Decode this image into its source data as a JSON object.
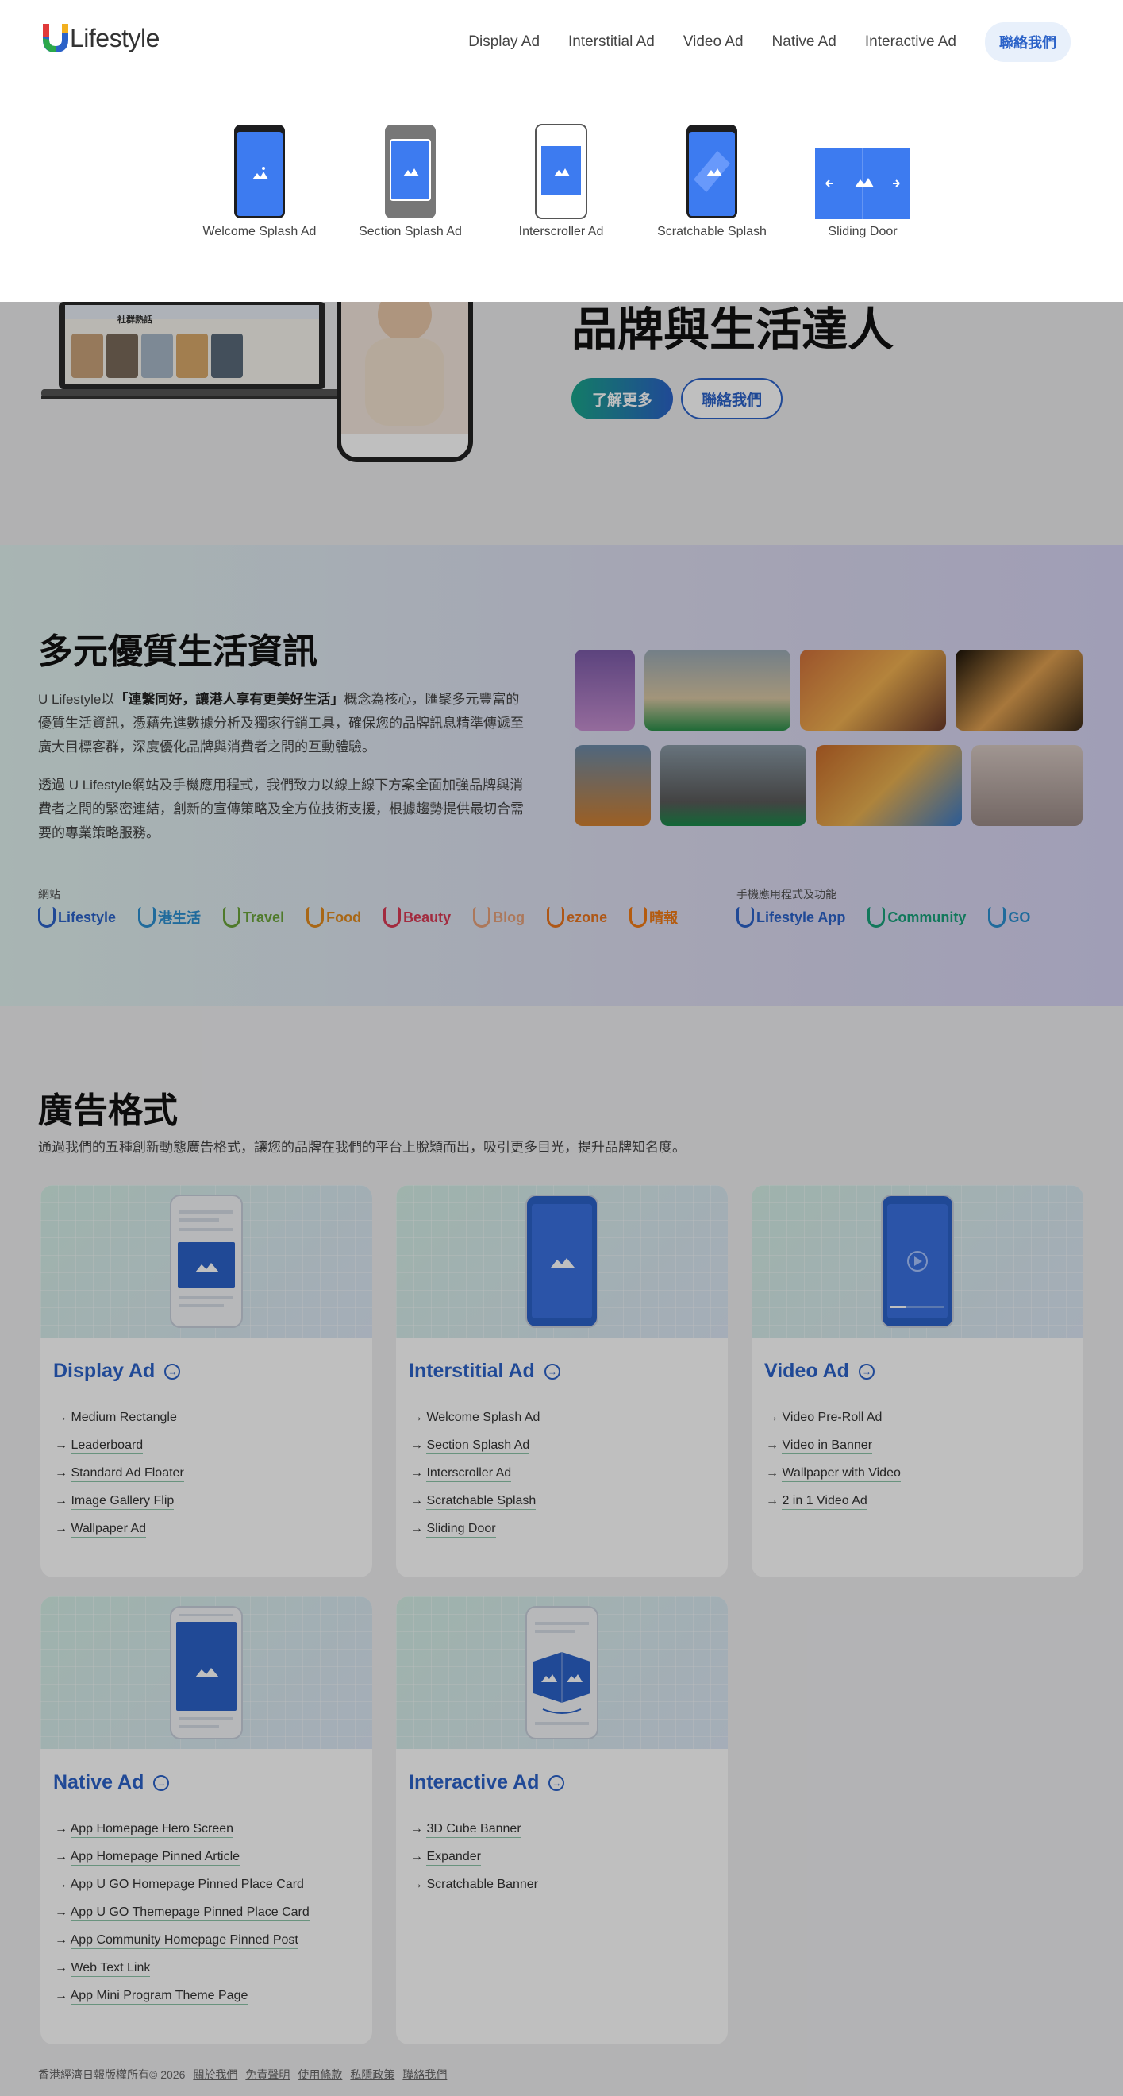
{
  "header": {
    "logo_text": "Lifestyle",
    "nav": [
      "Display Ad",
      "Interstitial Ad",
      "Video Ad",
      "Native Ad",
      "Interactive Ad"
    ],
    "contact_label": "聯絡我們"
  },
  "dropdown": {
    "items": [
      {
        "label": "Welcome Splash Ad"
      },
      {
        "label": "Section Splash Ad"
      },
      {
        "label": "Interscroller Ad"
      },
      {
        "label": "Scratchable Splash"
      },
      {
        "label": "Sliding Door"
      }
    ]
  },
  "hero": {
    "title": "品牌與生活達人",
    "learn_more": "了解更多",
    "contact": "聯絡我們",
    "laptop_heading": "社群熱話"
  },
  "info": {
    "title": "多元優質生活資訊",
    "para1_prefix": "U Lifestyle以",
    "para1_bold": "「連繫同好，讓港人享有更美好生活」",
    "para1_suffix": "概念為核心，匯聚多元豐富的優質生活資訊，憑藉先進數據分析及獨家行銷工具，確保您的品牌訊息精準傳遞至廣大目標客群，深度優化品牌與消費者之間的互動體驗。",
    "para2": "透過 U Lifestyle網站及手機應用程式，我們致力以線上線下方案全面加強品牌與消費者之間的緊密連結，創新的宣傳策略及全方位技術支援，根據趨勢提供最切合需要的專業策略服務。",
    "websites_label": "網站",
    "apps_label": "手機應用程式及功能",
    "websites": [
      {
        "name": "Lifestyle",
        "color": "#2b62c8"
      },
      {
        "name": "港生活",
        "color": "#2b8fd0"
      },
      {
        "name": "Travel",
        "color": "#6aa33a"
      },
      {
        "name": "Food",
        "color": "#e08a1e"
      },
      {
        "name": "Beauty",
        "color": "#d83a55"
      },
      {
        "name": "Blog",
        "color": "#e6a07a"
      },
      {
        "name": "ezone",
        "color": "#e8741e"
      },
      {
        "name": "晴報",
        "color": "#f07a14"
      }
    ],
    "apps": [
      {
        "name": "Lifestyle App",
        "color": "#2b62c8"
      },
      {
        "name": "Community",
        "color": "#18a07a"
      },
      {
        "name": "GO",
        "color": "#2b8fd0"
      }
    ]
  },
  "formats": {
    "title": "廣告格式",
    "subtitle": "通過我們的五種創新動態廣告格式，讓您的品牌在我們的平台上脫穎而出，吸引更多目光，提升品牌知名度。",
    "cards": [
      {
        "title": "Display Ad",
        "items": [
          "Medium Rectangle",
          "Leaderboard",
          "Standard Ad Floater",
          "Image Gallery Flip",
          "Wallpaper Ad"
        ]
      },
      {
        "title": "Interstitial Ad",
        "items": [
          "Welcome Splash Ad",
          "Section Splash Ad",
          "Interscroller Ad",
          "Scratchable Splash",
          "Sliding Door"
        ]
      },
      {
        "title": "Video Ad",
        "items": [
          "Video Pre-Roll Ad",
          "Video in Banner",
          "Wallpaper with Video",
          "2 in 1 Video Ad"
        ]
      },
      {
        "title": "Native Ad",
        "items": [
          "App Homepage Hero Screen",
          "App Homepage Pinned Article",
          "App U GO Homepage Pinned Place Card",
          "App U GO Themepage Pinned Place Card",
          "App Community Homepage Pinned Post",
          "Web Text Link",
          "App Mini Program Theme Page"
        ]
      },
      {
        "title": "Interactive Ad",
        "items": [
          "3D Cube Banner",
          "Expander",
          "Scratchable Banner"
        ]
      }
    ]
  },
  "footer": {
    "copyright": "香港經濟日報版權所有© 2026",
    "links": [
      "關於我們",
      "免責聲明",
      "使用條款",
      "私隱政策",
      "聯絡我們"
    ]
  },
  "colors": {
    "brand_blue": "#2b62c8",
    "accent_green": "#1aa58a",
    "overlay": "rgba(0,0,0,0.25)"
  }
}
